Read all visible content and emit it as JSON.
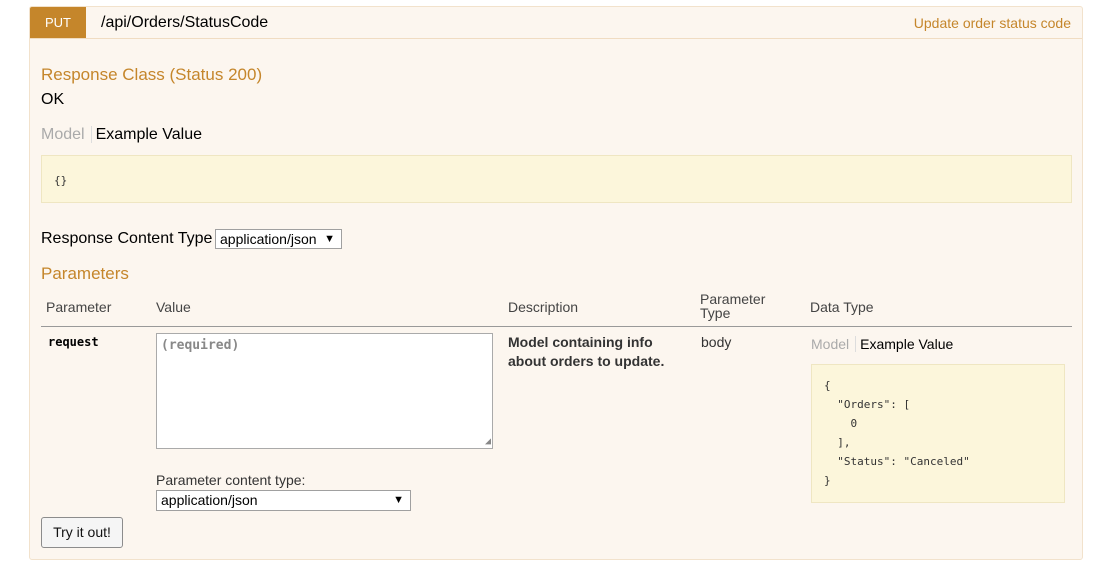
{
  "operation": {
    "method": "PUT",
    "path": "/api/Orders/StatusCode",
    "summary": "Update order status code"
  },
  "response_class": {
    "heading": "Response Class (Status 200)",
    "description": "OK",
    "tabs": {
      "model": "Model",
      "example": "Example Value"
    },
    "example": "{}"
  },
  "response_content_type": {
    "label": "Response Content Type",
    "selected": "application/json"
  },
  "parameters": {
    "heading": "Parameters",
    "columns": {
      "parameter": "Parameter",
      "value": "Value",
      "description": "Description",
      "param_type_line1": "Parameter",
      "param_type_line2": "Type",
      "data_type": "Data Type"
    },
    "rows": [
      {
        "name": "request",
        "value_placeholder": "(required)",
        "description": "Model containing info about orders to update.",
        "param_type": "body",
        "data_type_tabs": {
          "model": "Model",
          "example": "Example Value"
        },
        "example": "{\n  \"Orders\": [\n    0\n  ],\n  \"Status\": \"Canceled\"\n}",
        "content_type_label": "Parameter content type:",
        "content_type_selected": "application/json"
      }
    ]
  },
  "try_button": "Try it out!",
  "colors": {
    "accent": "#c5862b",
    "panel_bg": "#fcf6ef",
    "snippet_bg": "#fcf6db"
  }
}
